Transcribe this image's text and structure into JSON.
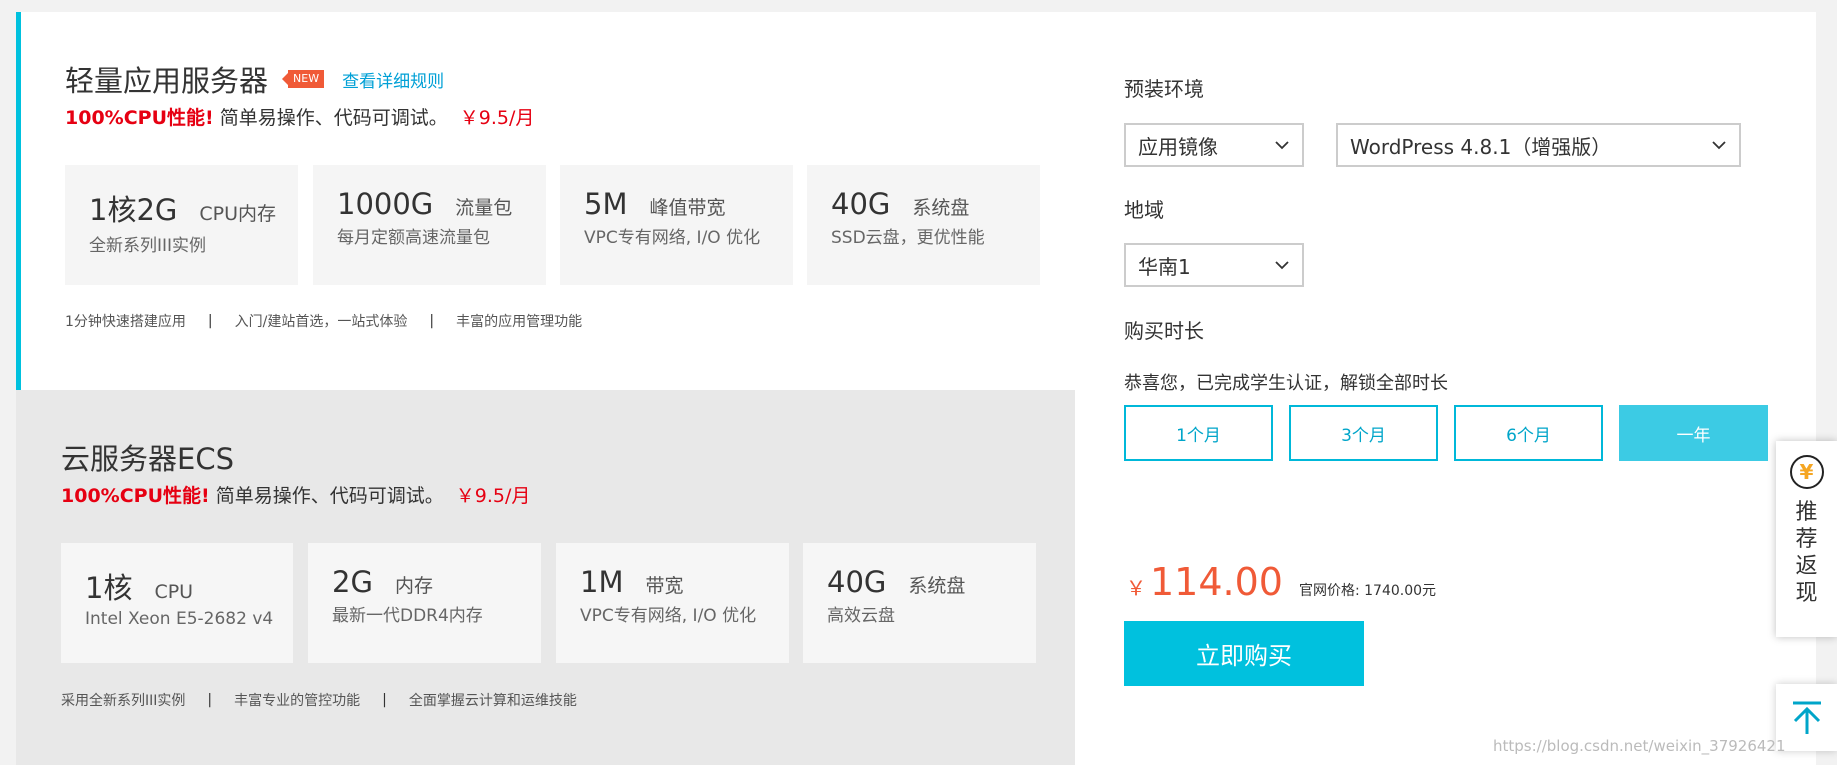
{
  "products": [
    {
      "title": "轻量应用服务器",
      "badge": "NEW",
      "link": "查看详细规则",
      "slogan_hot": "100%CPU性能!",
      "slogan_text": "简单易操作、代码可调试。",
      "slogan_price": "￥9.5/月",
      "specs": [
        {
          "value": "1核2G",
          "unit": "CPU内存",
          "sub": "全新系列III实例"
        },
        {
          "value": "1000G",
          "unit": "流量包",
          "sub": "每月定额高速流量包"
        },
        {
          "value": "5M",
          "unit": "峰值带宽",
          "sub": "VPC专有网络, I/O 优化"
        },
        {
          "value": "40G",
          "unit": "系统盘",
          "sub": "SSD云盘，更优性能"
        }
      ],
      "features": [
        "1分钟快速搭建应用",
        "入门/建站首选，一站式体验",
        "丰富的应用管理功能"
      ]
    },
    {
      "title": "云服务器ECS",
      "slogan_hot": "100%CPU性能!",
      "slogan_text": "简单易操作、代码可调试。",
      "slogan_price": "￥9.5/月",
      "specs": [
        {
          "value": "1核",
          "unit": "CPU",
          "sub": "Intel Xeon E5-2682 v4"
        },
        {
          "value": "2G",
          "unit": "内存",
          "sub": "最新一代DDR4内存"
        },
        {
          "value": "1M",
          "unit": "带宽",
          "sub": "VPC专有网络, I/O 优化"
        },
        {
          "value": "40G",
          "unit": "系统盘",
          "sub": "高效云盘"
        }
      ],
      "features": [
        "采用全新系列III实例",
        "丰富专业的管控功能",
        "全面掌握云计算和运维技能"
      ]
    }
  ],
  "separator": "|",
  "config": {
    "env_label": "预装环境",
    "image_type": "应用镜像",
    "image_name": "WordPress 4.8.1（增强版）",
    "region_label": "地域",
    "region": "华南1",
    "duration_label": "购买时长",
    "notice": "恭喜您，已完成学生认证，解锁全部时长",
    "durations": [
      "1个月",
      "3个月",
      "6个月",
      "一年"
    ],
    "active_duration_index": 3,
    "currency": "￥",
    "price": "114.00",
    "official_price": "官网价格: 1740.00元",
    "buy_label": "立即购买"
  },
  "side": {
    "yen_symbol": "¥",
    "referral_text": "推荐返现"
  },
  "watermark": "https://blog.csdn.net/weixin_37926421",
  "colors": {
    "accent": "#00c1de",
    "price": "#f05a37",
    "hot": "#e60012",
    "link": "#00a0d6"
  }
}
